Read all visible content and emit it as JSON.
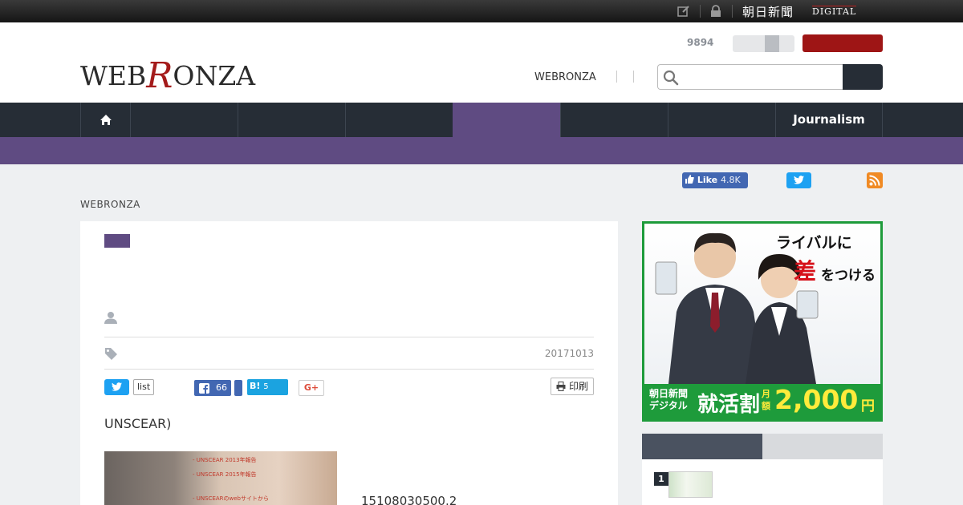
{
  "topbar": {
    "brand_jp": "朝日新聞",
    "brand_digital": "DIGITAL",
    "icons": [
      "edit-icon",
      "lock-icon"
    ]
  },
  "header": {
    "logo_left": "WEB",
    "logo_r": "R",
    "logo_right": "ONZA",
    "count": "9894",
    "link": "WEBRONZA",
    "search_placeholder": ""
  },
  "nav": {
    "journalism": "Journalism"
  },
  "social": {
    "fb_like": "Like",
    "fb_count": "4.8K"
  },
  "breadcrumb": "WEBRONZA",
  "article": {
    "date": "20171013",
    "share_list": "list",
    "fb_count": "66",
    "hatena_label": "B!",
    "hatena_count": "5",
    "gplus_label": "G+",
    "print_label": "印刷",
    "lead": "UNSCEAR)",
    "photo_caption": "15108030500.2"
  },
  "ad": {
    "copy1": "ライバルに",
    "copy2": "差",
    "copy3": "をつける",
    "brand": "朝日新聞デジタル",
    "offer": "就活割",
    "unit": "月額",
    "price": "2,000",
    "yen": "円"
  },
  "ranking": {
    "first_rank": "1"
  },
  "colors": {
    "accent_purple": "#5f4b82",
    "nav_dark": "#262d36",
    "brand_red": "#a41b1b",
    "ad_green": "#1e9b3b"
  }
}
